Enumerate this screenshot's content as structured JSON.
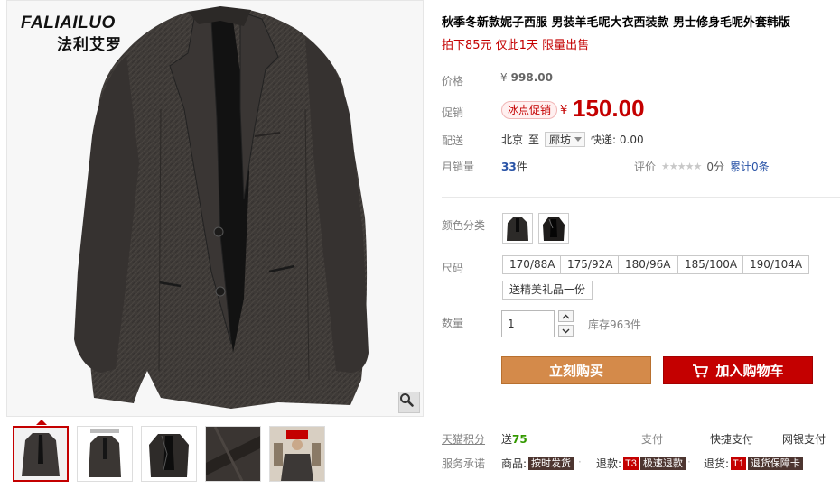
{
  "brand": {
    "name_en": "FALIAILUO",
    "name_cn": "法利艾罗"
  },
  "product": {
    "title": "秋季冬新款妮子西服 男装羊毛呢大衣西装款 男士修身毛呢外套韩版",
    "subtitle": "拍下85元 仅此1天 限量出售"
  },
  "price": {
    "label": "价格",
    "currency": "¥",
    "original": "998.00"
  },
  "promo": {
    "label": "促销",
    "tag": "冰点促销",
    "currency": "¥",
    "price": "150.00"
  },
  "shipping": {
    "label": "配送",
    "from": "北京",
    "to_word": "至",
    "dest": "廊坊",
    "express": "快递: 0.00"
  },
  "sales": {
    "label": "月销量",
    "count": "33",
    "unit": "件"
  },
  "rating": {
    "label": "评价",
    "stars": "★★★★★",
    "score": "0分",
    "reviews": "累计0条"
  },
  "color": {
    "label": "颜色分类",
    "options": [
      "black-suit-front",
      "black-suit-open"
    ]
  },
  "size": {
    "label": "尺码",
    "options": [
      "170/88A",
      "175/92A",
      "180/96A",
      "185/100A",
      "190/104A",
      "送精美礼品一份"
    ]
  },
  "quantity": {
    "label": "数量",
    "value": "1",
    "stock": "库存963件"
  },
  "buttons": {
    "buy_now": "立刻购买",
    "add_cart": "加入购物车"
  },
  "points": {
    "label": "天猫积分",
    "prefix": "送",
    "value": "75",
    "pay": "支付",
    "fast_pay": "快捷支付",
    "bank_pay": "网银支付"
  },
  "service": {
    "label": "服务承诺",
    "goods_label": "商品:",
    "goods_tag": "按时发货",
    "refund_label": "退款:",
    "refund_code": "T3",
    "refund_tag": "极速退款",
    "return_label": "退货:",
    "return_code": "T1",
    "return_tag": "退货保障卡"
  },
  "colors": {
    "accent_red": "#c40000",
    "buy_orange": "#d48a4a",
    "link_blue": "#2953a6",
    "points_green": "#339900"
  },
  "icons": [
    "zoom-icon",
    "cart-icon",
    "chevron-up-icon",
    "chevron-down-icon"
  ]
}
